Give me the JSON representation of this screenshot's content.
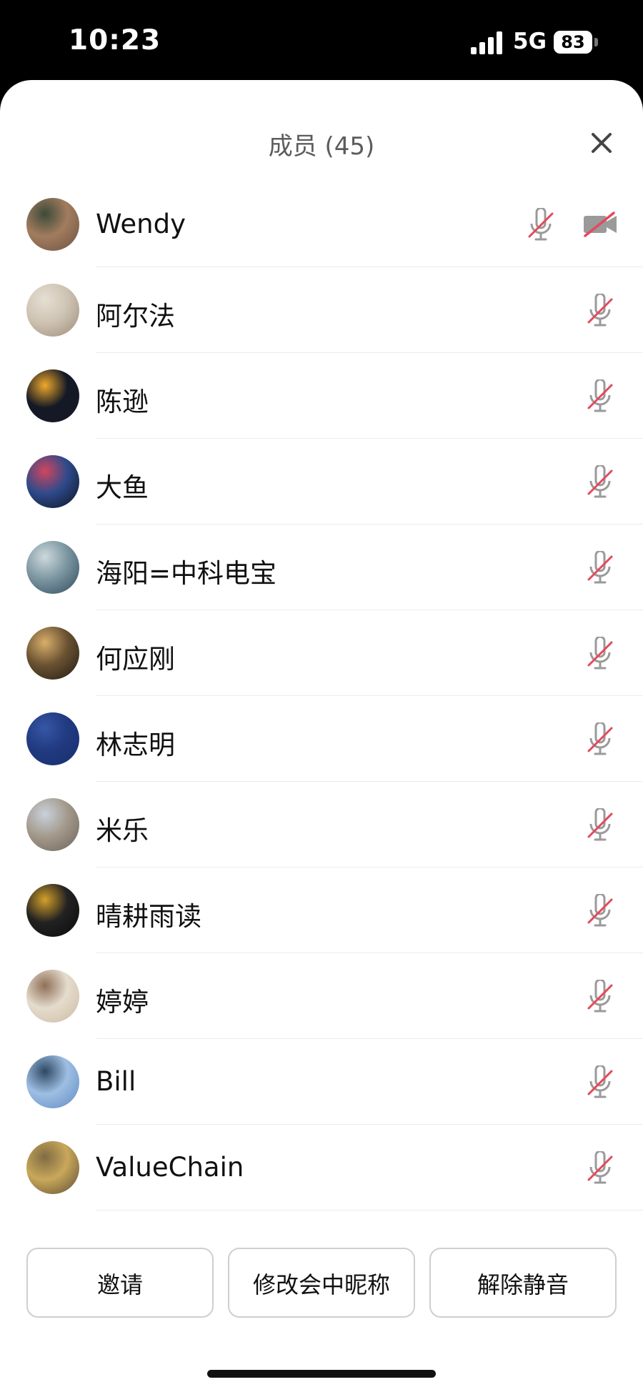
{
  "status_bar": {
    "time": "10:23",
    "network": "5G",
    "battery": "83"
  },
  "panel": {
    "title": "成员 (45)"
  },
  "members": [
    {
      "name": "Wendy",
      "avatar_colors": [
        "#6b5142",
        "#a27c5e",
        "#3d4a39"
      ],
      "mic": "muted",
      "video": "off"
    },
    {
      "name": "阿尔法",
      "avatar_colors": [
        "#9d8b77",
        "#cfc4b4",
        "#e5dfd2"
      ],
      "mic": "muted"
    },
    {
      "name": "陈逊",
      "avatar_colors": [
        "#141925",
        "#141925",
        "#f0a82c"
      ],
      "mic": "muted"
    },
    {
      "name": "大鱼",
      "avatar_colors": [
        "#0d1220",
        "#2e4a8b",
        "#d1455d"
      ],
      "mic": "muted"
    },
    {
      "name": "海阳=中科电宝",
      "avatar_colors": [
        "#2d4a5c",
        "#7c96a1",
        "#cdd9dc"
      ],
      "mic": "muted"
    },
    {
      "name": "何应刚",
      "avatar_colors": [
        "#1f1a13",
        "#6a5232",
        "#d9ae6a"
      ],
      "mic": "muted"
    },
    {
      "name": "林志明",
      "avatar_colors": [
        "#182f6e",
        "#213a80",
        "#3656a6"
      ],
      "mic": "muted"
    },
    {
      "name": "米乐",
      "avatar_colors": [
        "#6c6357",
        "#a39a8c",
        "#c9d1db"
      ],
      "mic": "muted"
    },
    {
      "name": "晴耕雨读",
      "avatar_colors": [
        "#0a0a0a",
        "#222",
        "#d4a02a"
      ],
      "mic": "muted"
    },
    {
      "name": "婷婷",
      "avatar_colors": [
        "#cbb9a2",
        "#e5dccd",
        "#8f6f57"
      ],
      "mic": "muted"
    },
    {
      "name": "Bill",
      "avatar_colors": [
        "#5e89c2",
        "#9ebfe3",
        "#2d4863"
      ],
      "mic": "muted"
    },
    {
      "name": "ValueChain",
      "avatar_colors": [
        "#5a4a33",
        "#c9a85a",
        "#806b44"
      ],
      "mic": "muted"
    }
  ],
  "actions": {
    "invite": "邀请",
    "rename": "修改会中昵称",
    "unmute": "解除静音"
  },
  "colors": {
    "muted_slash": "#e5495b",
    "icon_gray": "#9a9a9a",
    "border": "#cfcfcf"
  }
}
